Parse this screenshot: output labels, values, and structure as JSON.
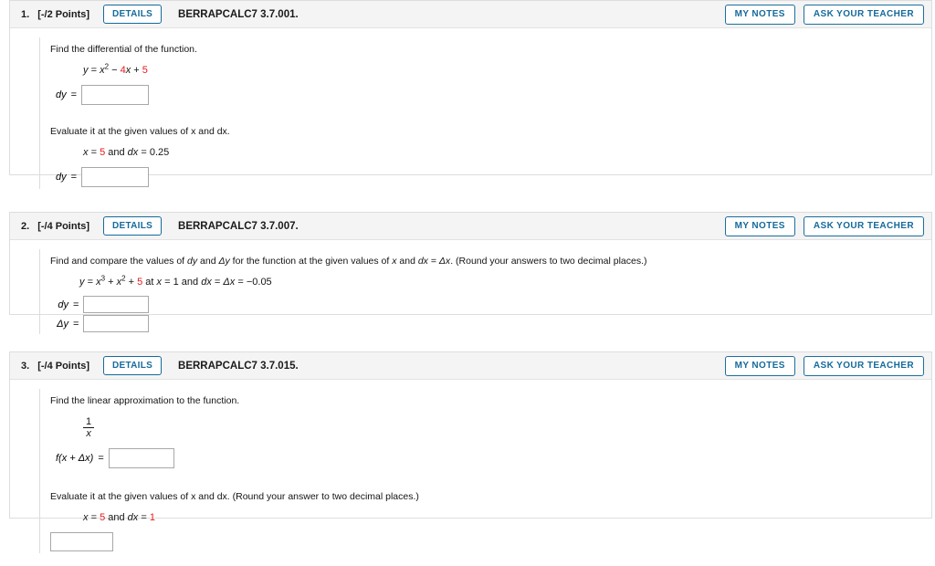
{
  "page": {
    "background": "#ffffff",
    "accent_blue": "#156a9b",
    "value_red": "#e8191b",
    "header_band": "#f4f4f4",
    "card_border": "#dddddd"
  },
  "common": {
    "details_label": "DETAILS",
    "my_notes_label": "MY NOTES",
    "ask_teacher_label": "ASK YOUR TEACHER"
  },
  "problems": [
    {
      "number": "1.",
      "points": "[-/2 Points]",
      "code": "BERRAPCALC7 3.7.001.",
      "prompt1": "Find the differential of the function.",
      "equation1": {
        "lhs": "y",
        "eq": "=",
        "term1": "x",
        "exp1": "2",
        "op1": "−",
        "coef2": "4",
        "var2": "x",
        "op2": "+",
        "const": "5"
      },
      "answer_label1": "dy",
      "answer_eq1": "=",
      "answer_value1": "",
      "prompt2": "Evaluate it at the given values of x and dx.",
      "given": {
        "x_label": "x",
        "x_eq": "=",
        "x_value": "5",
        "and": "and",
        "dx_label": "dx",
        "dx_eq": "=",
        "dx_value": "0.25"
      },
      "answer_label2": "dy",
      "answer_eq2": "=",
      "answer_value2": ""
    },
    {
      "number": "2.",
      "points": "[-/4 Points]",
      "code": "BERRAPCALC7 3.7.007.",
      "prompt1_a": "Find and compare the values of ",
      "prompt1_dy": "dy",
      "prompt1_b": " and ",
      "prompt1_dyd": "Δy",
      "prompt1_c": " for the function at the given values of ",
      "prompt1_x": "x",
      "prompt1_d": " and  ",
      "prompt1_dx": "dx",
      "prompt1_e": " = ",
      "prompt1_dxd": "Δx",
      "prompt1_f": ".  (Round your answers to two decimal places.)",
      "equation1": {
        "lhs": "y",
        "eq": "=",
        "t1": "x",
        "e1": "3",
        "op1": "+",
        "t2": "x",
        "e2": "2",
        "op2": "+",
        "const": "5",
        "at": "at",
        "x_label": "x",
        "x_eq": "=",
        "x_value": "1",
        "and": "and",
        "dx_label": "dx",
        "dx_eq": "=",
        "dxd_label": "Δx",
        "dx_eq2": "=",
        "dx_value": "−0.05"
      },
      "answer_label1": "dy",
      "answer_eq1": "=",
      "answer_value1": "",
      "answer_label2": "Δy",
      "answer_eq2": "=",
      "answer_value2": ""
    },
    {
      "number": "3.",
      "points": "[-/4 Points]",
      "code": "BERRAPCALC7 3.7.015.",
      "prompt1": "Find the linear approximation to the function.",
      "fraction": {
        "numerator": "1",
        "denominator": "x"
      },
      "answer_label1": "f(x + Δx)",
      "answer_eq1": "=",
      "answer_value1": "",
      "prompt2": "Evaluate it at the given values of x and dx. (Round your answer to two decimal places.)",
      "given": {
        "x_label": "x",
        "x_eq": "=",
        "x_value": "5",
        "and": "and",
        "dx_label": "dx",
        "dx_eq": "=",
        "dx_value": "1"
      },
      "answer_value2": ""
    }
  ]
}
